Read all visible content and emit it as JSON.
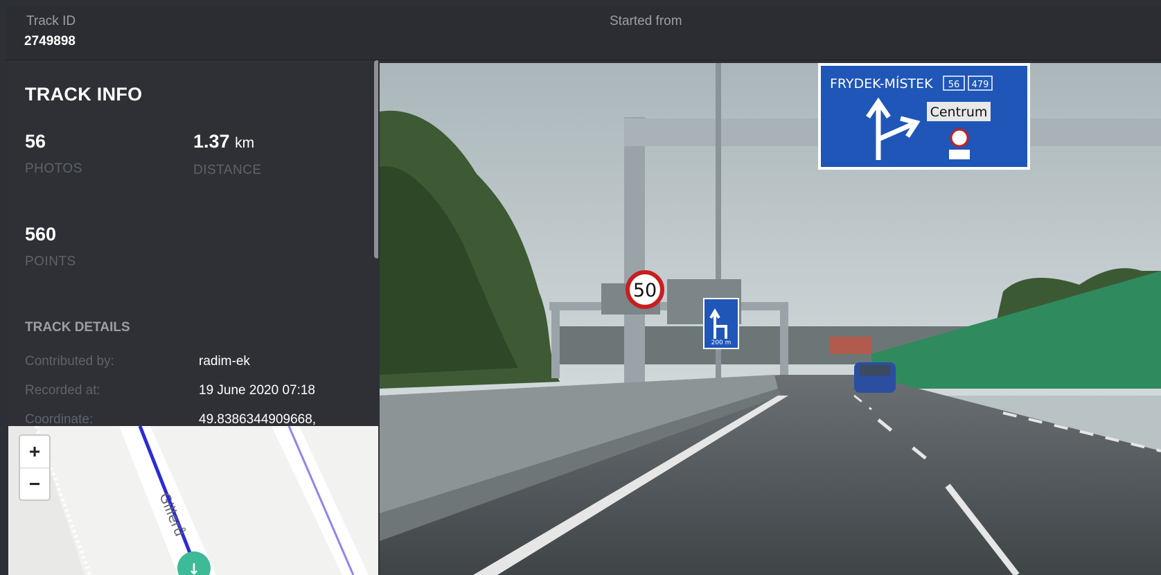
{
  "header": {
    "track_id_label": "Track ID",
    "track_id_value": "2749898",
    "started_from_label": "Started from"
  },
  "track_info": {
    "title": "TRACK INFO",
    "photos": {
      "value": "56",
      "label": "PHOTOS"
    },
    "distance": {
      "value": "1.37",
      "unit": "km",
      "label": "DISTANCE"
    },
    "points": {
      "value": "560",
      "label": "POINTS"
    }
  },
  "track_details": {
    "title": "TRACK DETAILS",
    "rows": [
      {
        "key": "Contributed by:",
        "value": "radim-ek"
      },
      {
        "key": "Recorded at:",
        "value": "19 June 2020 07:18"
      },
      {
        "key": "Coordinate:",
        "value": "49.8386344909668,"
      }
    ]
  },
  "map": {
    "zoom_in": "+",
    "zoom_out": "−",
    "street_label": "Gillerů"
  },
  "photo": {
    "sign_city": "FRYDEK-MÍSTEK",
    "sign_route_1": "56",
    "sign_route_2": "479",
    "sign_centrum": "Centrum",
    "speed_limit": "50",
    "lane_sign_distance": "200 m"
  },
  "colors": {
    "background": "#2d2f36",
    "route_line": "#2b2bd8",
    "marker": "#3dba98",
    "sign_blue": "#1f56b8"
  }
}
